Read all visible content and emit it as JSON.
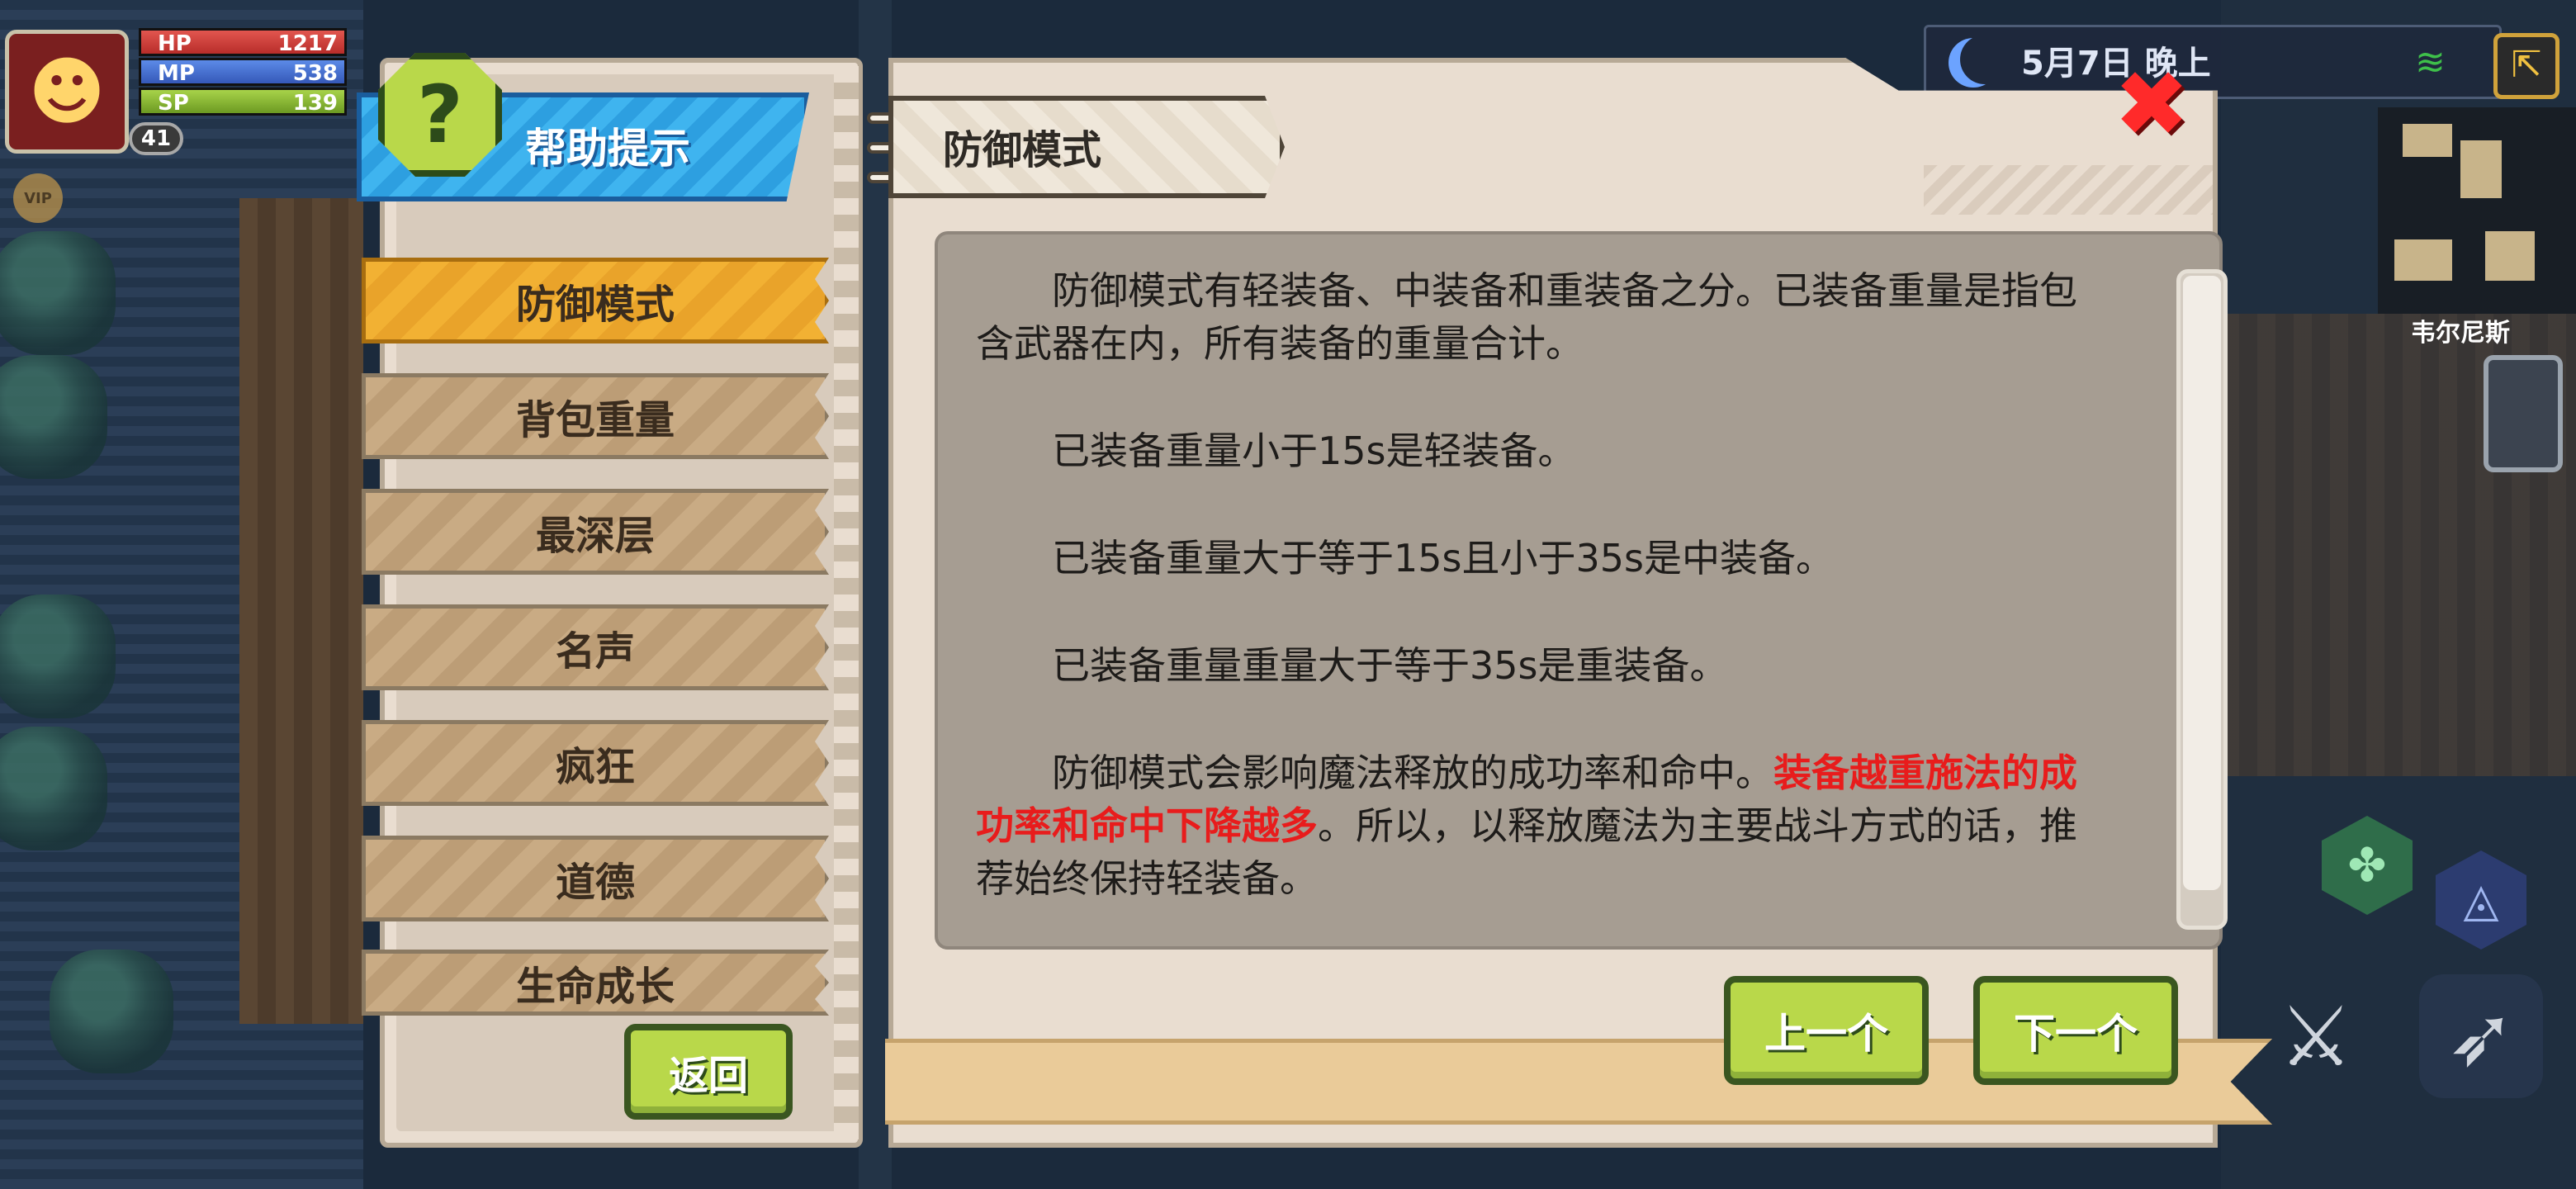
{
  "player": {
    "hp_label": "HP",
    "hp_value": "1217",
    "mp_label": "MP",
    "mp_value": "538",
    "sp_label": "SP",
    "sp_value": "139",
    "level": "41",
    "vip_label": "VIP",
    "avatar_icon": "demon-face-icon"
  },
  "status_bar": {
    "date_time": "5月7日 晚上",
    "location": "韦尔尼斯",
    "moon_icon": "moon-icon",
    "wifi_icon": "wifi-icon",
    "exit_icon": "exit-door-icon"
  },
  "help_panel": {
    "title": "帮助提示",
    "back_label": "返回",
    "menu_items": [
      {
        "label": "防御模式",
        "active": true
      },
      {
        "label": "背包重量",
        "active": false
      },
      {
        "label": "最深层",
        "active": false
      },
      {
        "label": "名声",
        "active": false
      },
      {
        "label": "疯狂",
        "active": false
      },
      {
        "label": "道德",
        "active": false
      },
      {
        "label": "生命成长",
        "active": false
      }
    ]
  },
  "detail": {
    "page_title": "防御模式",
    "paragraph_1": "防御模式有轻装备、中装备和重装备之分。已装备重量是指包含武器在内，所有装备的重量合计。",
    "paragraph_2": "已装备重量小于15s是轻装备。",
    "paragraph_3": "已装备重量大于等于15s且小于35s是中装备。",
    "paragraph_4": "已装备重量重量大于等于35s是重装备。",
    "paragraph_5_part_1": "防御模式会影响魔法释放的成功率和命中。",
    "paragraph_5_highlight": "装备越重施法的成功率和命中下降越多",
    "paragraph_5_part_2": "。所以，以释放魔法为主要战斗方式的话，推荐始终保持轻装备。",
    "prev_label": "上一个",
    "next_label": "下一个",
    "close_icon": "close-icon"
  },
  "colors": {
    "highlight": "#e81c1c",
    "active_tab": "#f2b133",
    "button_green": "#b9d84a",
    "title_blue": "#3fb4ef"
  }
}
